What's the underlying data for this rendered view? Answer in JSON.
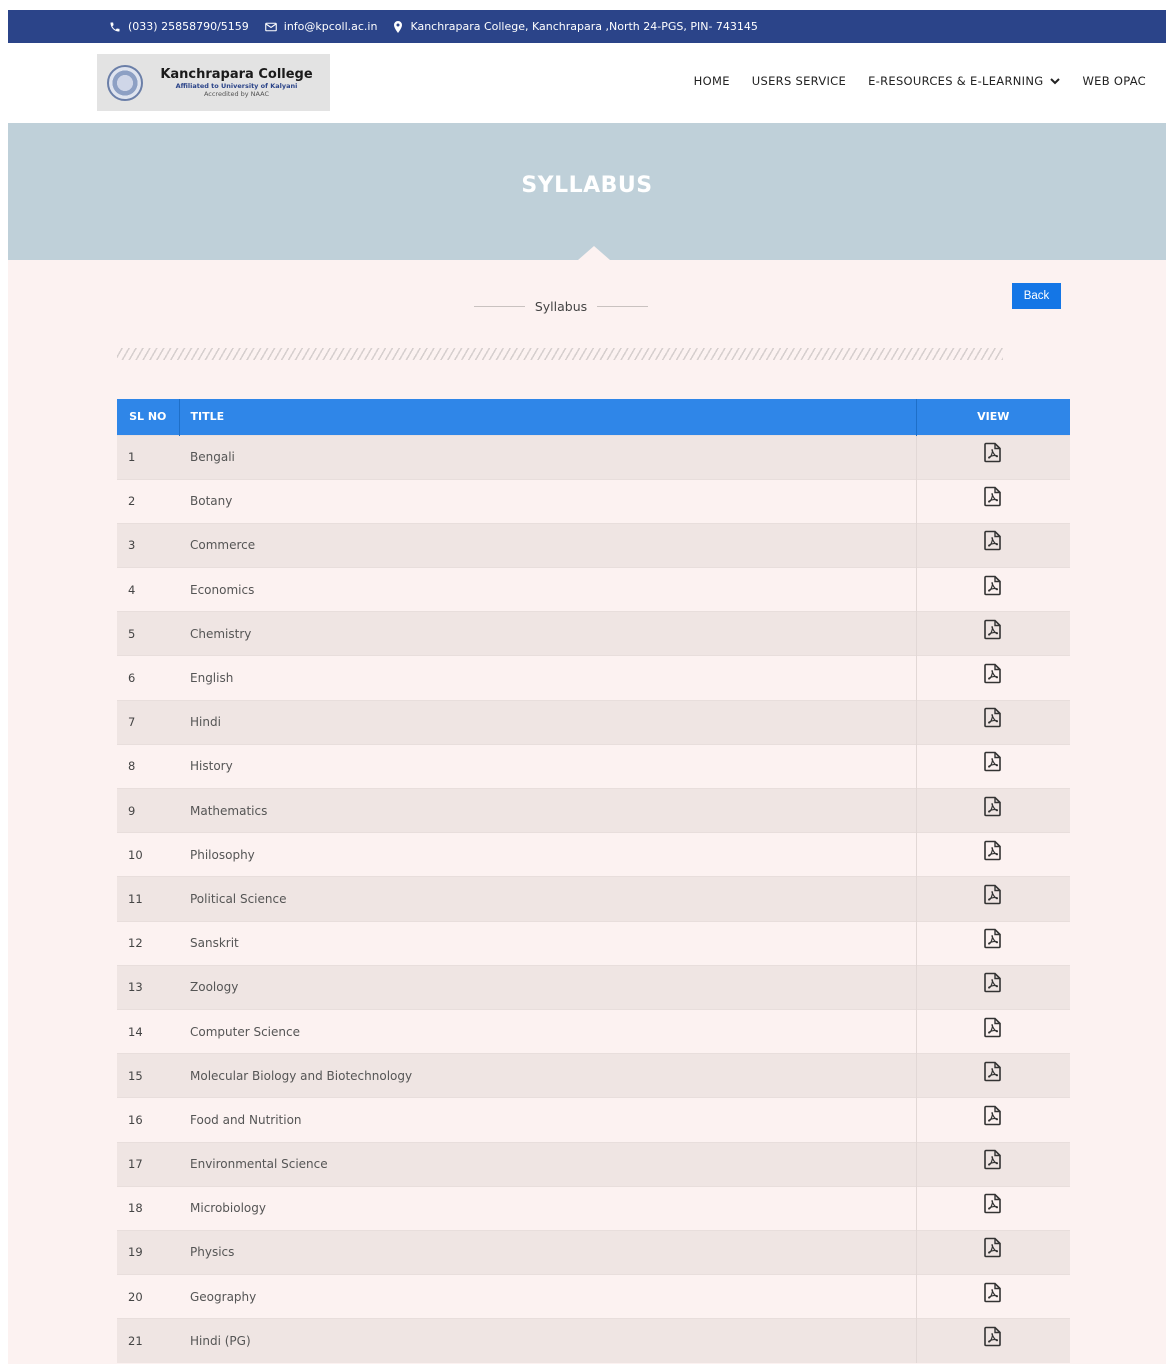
{
  "topbar": {
    "phone": "(033) 25858790/5159",
    "email": "info@kpcoll.ac.in",
    "address": "Kanchrapara College, Kanchrapara ,North 24-PGS, PIN- 743145"
  },
  "logo": {
    "title": "Kanchrapara College",
    "affiliation": "Affiliated to University of Kalyani",
    "accreditation": "Accredited by NAAC"
  },
  "nav": {
    "home": "HOME",
    "users_service": "USERS SERVICE",
    "e_resources": "E-RESOURCES & E-LEARNING",
    "web_opac": "WEB OPAC"
  },
  "banner": {
    "title": "SYLLABUS"
  },
  "content": {
    "back_label": "Back",
    "section_title": "Syllabus"
  },
  "table": {
    "headers": {
      "sl": "SL NO",
      "title": "TITLE",
      "view": "VIEW"
    },
    "rows": [
      {
        "sl": "1",
        "title": "Bengali"
      },
      {
        "sl": "2",
        "title": "Botany"
      },
      {
        "sl": "3",
        "title": "Commerce"
      },
      {
        "sl": "4",
        "title": "Economics"
      },
      {
        "sl": "5",
        "title": "Chemistry"
      },
      {
        "sl": "6",
        "title": "English"
      },
      {
        "sl": "7",
        "title": "Hindi"
      },
      {
        "sl": "8",
        "title": "History"
      },
      {
        "sl": "9",
        "title": "Mathematics"
      },
      {
        "sl": "10",
        "title": "Philosophy"
      },
      {
        "sl": "11",
        "title": "Political Science"
      },
      {
        "sl": "12",
        "title": "Sanskrit"
      },
      {
        "sl": "13",
        "title": "Zoology"
      },
      {
        "sl": "14",
        "title": "Computer Science"
      },
      {
        "sl": "15",
        "title": "Molecular Biology and Biotechnology"
      },
      {
        "sl": "16",
        "title": "Food and Nutrition"
      },
      {
        "sl": "17",
        "title": "Environmental Science"
      },
      {
        "sl": "18",
        "title": "Microbiology"
      },
      {
        "sl": "19",
        "title": "Physics"
      },
      {
        "sl": "20",
        "title": "Geography"
      },
      {
        "sl": "21",
        "title": "Hindi (PG)"
      }
    ]
  },
  "icons": {
    "view": "pdf-file-icon",
    "phone": "phone-icon",
    "email": "envelope-icon",
    "address": "map-pin-icon",
    "dropdown": "chevron-down-icon"
  },
  "colors": {
    "topbar": "#2b4489",
    "banner": "#bfd0d9",
    "table_header": "#2f86e8",
    "back_button": "#1476e6",
    "page_bg": "#fcf2f1"
  }
}
